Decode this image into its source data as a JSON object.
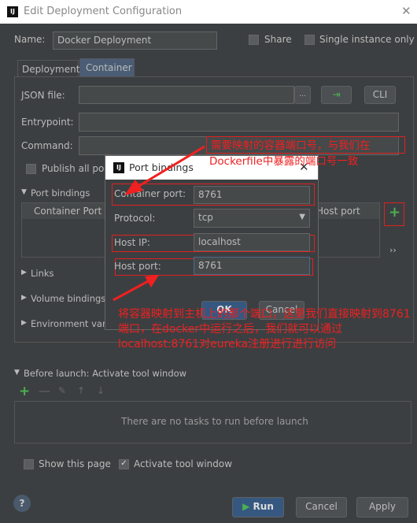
{
  "window": {
    "title": "Edit Deployment Configuration",
    "logo": "IJ",
    "close": "✕"
  },
  "name": {
    "label": "Name:",
    "value": "Docker Deployment",
    "share": "Share",
    "single": "Single instance only"
  },
  "tabs": [
    "Deployment",
    "Container"
  ],
  "container": {
    "json_label": "JSON file:",
    "browse": "...",
    "cli": "CLI",
    "entry_label": "Entrypoint:",
    "command_label": "Command:",
    "publish": "Publish all po",
    "port_bindings": "Port bindings",
    "col_container": "Container Port",
    "col_host": "Host port",
    "more": "››",
    "links": "Links",
    "volume": "Volume bindings",
    "env": "Environment varia"
  },
  "dialog": {
    "title": "Port bindings",
    "container_port_label": "Container port:",
    "container_port": "8761",
    "protocol_label": "Protocol:",
    "protocol": "tcp",
    "host_ip_label": "Host IP:",
    "host_ip": "localhost",
    "host_port_label": "Host port:",
    "host_port": "8761",
    "ok": "OK",
    "cancel": "Cancel"
  },
  "annotations": {
    "top": "需要映射的容器端口号，与我们在",
    "top2": "Dockerfile中暴露的端口号一致",
    "bottom": "将容器映射到主机上的那个端口，这里我们直接映射到8761端口，在docker中运行之后，我们就可以通过localhost:8761对eureka注册进行进行访问"
  },
  "before_launch": {
    "title": "Before launch: Activate tool window",
    "empty": "There are no tasks to run before launch"
  },
  "footer": {
    "show_page": "Show this page",
    "activate": "Activate tool window",
    "help": "?",
    "run": "Run",
    "cancel": "Cancel",
    "apply": "Apply"
  },
  "colors": {
    "accent": "#365880",
    "annotation": "#f02020",
    "add": "#3c9a3c"
  }
}
